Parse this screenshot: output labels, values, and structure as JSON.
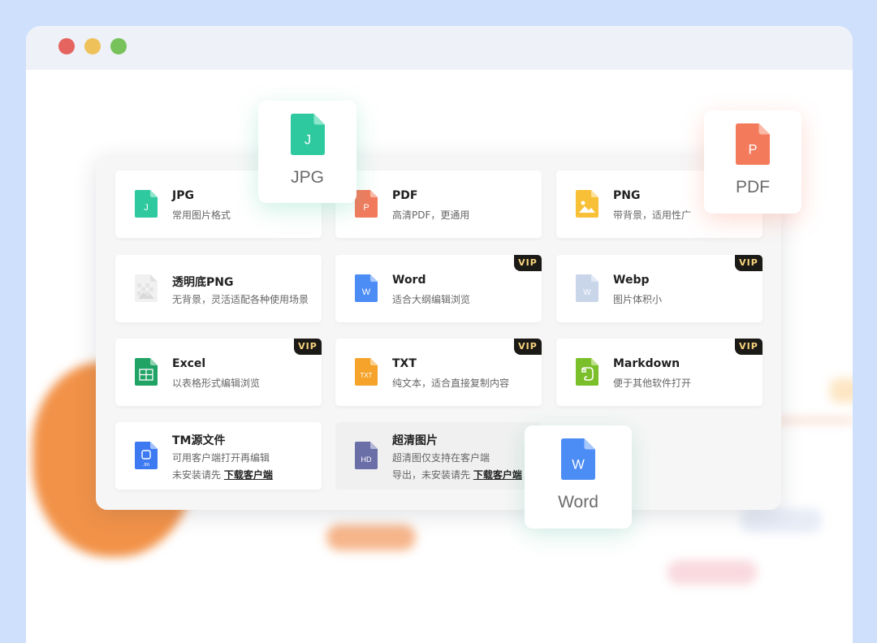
{
  "window": {
    "controls": [
      "close",
      "minimize",
      "maximize"
    ]
  },
  "colors": {
    "background": "#cfe0fd",
    "jpg": "#2fc9a0",
    "pdf": "#f47a5c",
    "png": "#f8c037",
    "word": "#4b8cf5",
    "webp": "#c9d6ea",
    "excel": "#21a366",
    "txt": "#f5a32a",
    "markdown": "#7bbf2a",
    "tm": "#3d7af2",
    "hd": "#6a6fa8",
    "vip_bg": "#1c1a17",
    "vip_text": "#f6d37c"
  },
  "formats": {
    "jpg": {
      "title": "JPG",
      "desc": "常用图片格式",
      "icon": "jpg-file-icon",
      "glyph": "J"
    },
    "pdf": {
      "title": "PDF",
      "desc": "高清PDF，更通用",
      "icon": "pdf-file-icon",
      "glyph": "P"
    },
    "png": {
      "title": "PNG",
      "desc": "带背景，适用性广",
      "icon": "png-image-icon"
    },
    "png_transparent": {
      "title": "透明底PNG",
      "desc": "无背景，灵活适配各种使用场景",
      "icon": "transparent-png-icon"
    },
    "word": {
      "title": "Word",
      "desc": "适合大纲编辑浏览",
      "icon": "word-file-icon",
      "glyph": "W",
      "badge": "VIP"
    },
    "webp": {
      "title": "Webp",
      "desc": "图片体积小",
      "icon": "webp-file-icon",
      "glyph": "W",
      "badge": "VIP"
    },
    "excel": {
      "title": "Excel",
      "desc": "以表格形式编辑浏览",
      "icon": "excel-file-icon",
      "badge": "VIP"
    },
    "txt": {
      "title": "TXT",
      "desc": "纯文本，适合直接复制内容",
      "icon": "txt-file-icon",
      "glyph": "TXT",
      "badge": "VIP"
    },
    "markdown": {
      "title": "Markdown",
      "desc": "便于其他软件打开",
      "icon": "evernote-markdown-icon",
      "badge": "VIP"
    },
    "tm": {
      "title": "TM源文件",
      "desc": "可用客户端打开再编辑",
      "desc2_prefix": "未安装请先",
      "link": "下载客户端",
      "icon": "tm-source-file-icon",
      "glyph": ".tm"
    },
    "hd": {
      "title": "超清图片",
      "desc": "超清图仅支持在客户端",
      "desc2_prefix": "导出，未安装请先",
      "link": "下载客户端",
      "icon": "hd-image-icon",
      "glyph": "HD"
    }
  },
  "floating": {
    "jpg": {
      "label": "JPG",
      "glyph": "J"
    },
    "pdf": {
      "label": "PDF",
      "glyph": "P"
    },
    "word": {
      "label": "Word",
      "glyph": "W"
    }
  }
}
